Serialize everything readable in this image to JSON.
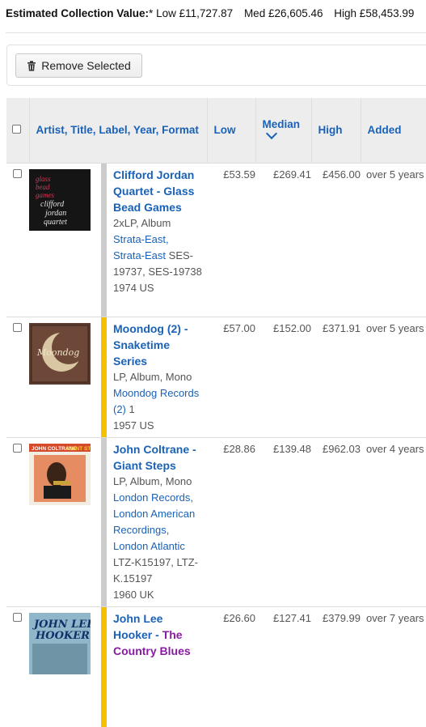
{
  "summary": {
    "label": "Estimated Collection Value:",
    "asterisk": "*",
    "low": "Low £11,727.87",
    "med": "Med £26,605.46",
    "high": "High £58,453.99"
  },
  "toolbar": {
    "remove_label": "Remove Selected",
    "remove_icon": "trash-icon"
  },
  "columns": {
    "artist": "Artist",
    "title": "Title",
    "label": "Label",
    "year": "Year",
    "format": "Format",
    "low": "Low",
    "median": "Median",
    "high": "High",
    "added": "Added"
  },
  "rows": [
    {
      "artist": "Clifford Jordan Quartet",
      "title": "Glass Bead Games",
      "format": "2xLP, Album",
      "labels": [
        "Strata-East,",
        "Strata-East"
      ],
      "catno": "SES-19737, SES-19738",
      "year_country": "1974 US",
      "low": "£53.59",
      "median": "£269.41",
      "high": "£456.00",
      "added": "over 5 years",
      "stripe": "#cccccc"
    },
    {
      "artist": "Moondog (2)",
      "title": "Snaketime Series",
      "format": "LP, Album, Mono",
      "labels": [
        "Moondog Records (2)"
      ],
      "catno": "1",
      "year_country": "1957 US",
      "low": "£57.00",
      "median": "£152.00",
      "high": "£371.91",
      "added": "over 5 years",
      "stripe": "#f5c000"
    },
    {
      "artist": "John Coltrane",
      "title": "Giant Steps",
      "format": "LP, Album, Mono",
      "labels": [
        "London Records,",
        "London American Recordings,",
        "London Atlantic"
      ],
      "catno": "LTZ-K15197, LTZ-K.15197",
      "year_country": "1960 UK",
      "low": "£28.86",
      "median": "£139.48",
      "high": "£962.03",
      "added": "over 4 years",
      "stripe": "#cccccc"
    },
    {
      "artist": "John Lee Hooker",
      "title": "The Country Blues",
      "low": "£26.60",
      "median": "£127.41",
      "high": "£379.99",
      "added": "over 7 years",
      "stripe": "#f5c000"
    }
  ],
  "theme": {
    "link": "#1a62b8",
    "release_link": "#8b1aa3",
    "header_bg": "#ededed",
    "stripe_grey": "#cccccc",
    "stripe_yellow": "#f5c000"
  }
}
